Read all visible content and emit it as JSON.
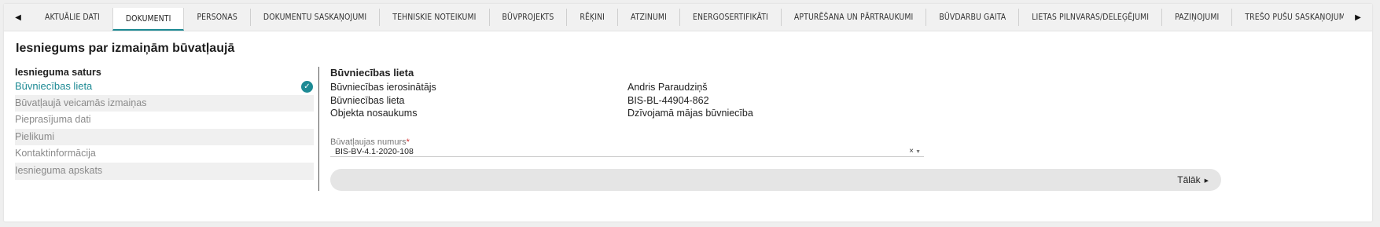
{
  "tabbar": {
    "tabs": [
      {
        "label": "AKTUĀLIE DATI",
        "name": "tab-aktualie-dati"
      },
      {
        "label": "DOKUMENTI",
        "name": "tab-dokumenti",
        "active": true
      },
      {
        "label": "PERSONAS",
        "name": "tab-personas"
      },
      {
        "label": "DOKUMENTU SASKAŅOJUMI",
        "name": "tab-dokumentu-saskanojumi"
      },
      {
        "label": "TEHNISKIE NOTEIKUMI",
        "name": "tab-tehniskie-noteikumi"
      },
      {
        "label": "BŪVPROJEKTS",
        "name": "tab-buvprojekts"
      },
      {
        "label": "RĒĶINI",
        "name": "tab-rekini"
      },
      {
        "label": "ATZINUMI",
        "name": "tab-atzinumi"
      },
      {
        "label": "ENERGOSERTIFIKĀTI",
        "name": "tab-energosertifikati"
      },
      {
        "label": "APTURĒŠANA UN PĀRTRAUKUMI",
        "name": "tab-apturesana"
      },
      {
        "label": "BŪVDARBU GAITA",
        "name": "tab-buvdarbu-gaita"
      },
      {
        "label": "LIETAS PILNVARAS/DELEĢĒJUMI",
        "name": "tab-lietas-pilnvaras"
      },
      {
        "label": "PAZIŅOJUMI",
        "name": "tab-pazinojumi"
      },
      {
        "label": "TREŠO PUŠU SASKAŅOJUMI",
        "name": "tab-treso-pusu-saskanojumi"
      }
    ],
    "left_arrow": "◀",
    "right_arrow": "▶"
  },
  "page_title": "Iesniegums par izmaiņām būvatļaujā",
  "side": {
    "heading": "Iesnieguma saturs",
    "items": [
      {
        "label": "Būvniecības lieta",
        "active": true,
        "completed": true
      },
      {
        "label": "Būvatļaujā veicamās izmaiņas"
      },
      {
        "label": "Pieprasījuma dati"
      },
      {
        "label": "Pielikumi"
      },
      {
        "label": "Kontaktinformācija"
      },
      {
        "label": "Iesnieguma apskats"
      }
    ],
    "check_glyph": "✓"
  },
  "main": {
    "section_title": "Būvniecības lieta",
    "rows": [
      {
        "key": "Būvniecības ierosinātājs",
        "value": "Andris Paraudziņš"
      },
      {
        "key": "Būvniecības lieta",
        "value": "BIS-BL-44904-862"
      },
      {
        "key": "Objekta nosaukums",
        "value": "Dzīvojamā mājas būvniecība"
      }
    ],
    "field": {
      "label": "Būvatļaujas numurs",
      "required_mark": "*",
      "value": "BIS-BV-4.1-2020-108",
      "clear_glyph": "×",
      "caret_glyph": "▼"
    }
  },
  "footer": {
    "next_label": "Tālāk",
    "next_arrow": "▶"
  },
  "colors": {
    "accent": "#1d8a94",
    "required": "#d12b2b",
    "shade": "#f0f0f0"
  }
}
